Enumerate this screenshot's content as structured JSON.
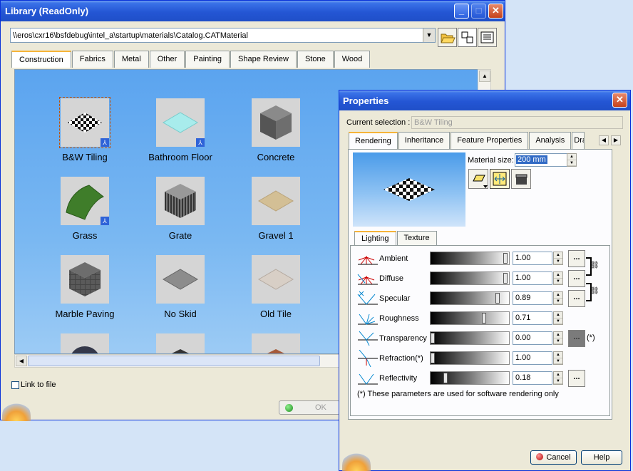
{
  "library": {
    "title": "Library (ReadOnly)",
    "path": "\\\\eros\\cxr16\\bsfdebug\\intel_a\\startup\\materials\\Catalog.CATMaterial",
    "tabs": [
      "Construction",
      "Fabrics",
      "Metal",
      "Other",
      "Painting",
      "Shape Review",
      "Stone",
      "Wood"
    ],
    "active_tab": "Construction",
    "materials": [
      {
        "label": "B&W Tiling",
        "thumb": "checker-tile",
        "selected": true,
        "linked": true
      },
      {
        "label": "Bathroom Floor",
        "thumb": "cyan-tile",
        "selected": false,
        "linked": true
      },
      {
        "label": "Concrete",
        "thumb": "grey-cube",
        "selected": false,
        "linked": false
      },
      {
        "label": "Grass",
        "thumb": "grass-sheet",
        "selected": false,
        "linked": true
      },
      {
        "label": "Grate",
        "thumb": "striped-cube",
        "selected": false,
        "linked": false
      },
      {
        "label": "Gravel 1",
        "thumb": "sand-tile",
        "selected": false,
        "linked": false
      },
      {
        "label": "Marble Paving",
        "thumb": "dark-cube",
        "selected": false,
        "linked": false
      },
      {
        "label": "No Skid",
        "thumb": "grey-tile",
        "selected": false,
        "linked": false
      },
      {
        "label": "Old Tile",
        "thumb": "pale-tile",
        "selected": false,
        "linked": false
      }
    ],
    "link_to_file": "Link to file",
    "ok": "OK"
  },
  "properties": {
    "title": "Properties",
    "current_selection_label": "Current selection :",
    "current_selection_value": "B&W Tiling",
    "tabs": [
      "Rendering",
      "Inheritance",
      "Feature Properties",
      "Analysis",
      "Dra"
    ],
    "active_tab": "Rendering",
    "material_size_label": "Material size:",
    "material_size_value": "200 mm",
    "subtabs": [
      "Lighting",
      "Texture"
    ],
    "active_subtab": "Lighting",
    "params": [
      {
        "label": "Ambient",
        "value": "1.00",
        "level": 1.0
      },
      {
        "label": "Diffuse",
        "value": "1.00",
        "level": 1.0
      },
      {
        "label": "Specular",
        "value": "0.89",
        "level": 0.89
      },
      {
        "label": "Roughness",
        "value": "0.71",
        "level": 0.71
      },
      {
        "label": "Transparency",
        "value": "0.00",
        "level": 0.0,
        "note": "(*)"
      },
      {
        "label": "Refraction(*)",
        "value": "1.00",
        "level": 0.0
      },
      {
        "label": "Reflectivity",
        "value": "0.18",
        "level": 0.18
      }
    ],
    "footnote": "(*) These parameters are used for software rendering only",
    "cancel": "Cancel",
    "help": "Help"
  },
  "colors": {
    "titlebar": "#2456d4",
    "gallery_bg": "#7ab8f2",
    "window_bg": "#ece9d8"
  }
}
